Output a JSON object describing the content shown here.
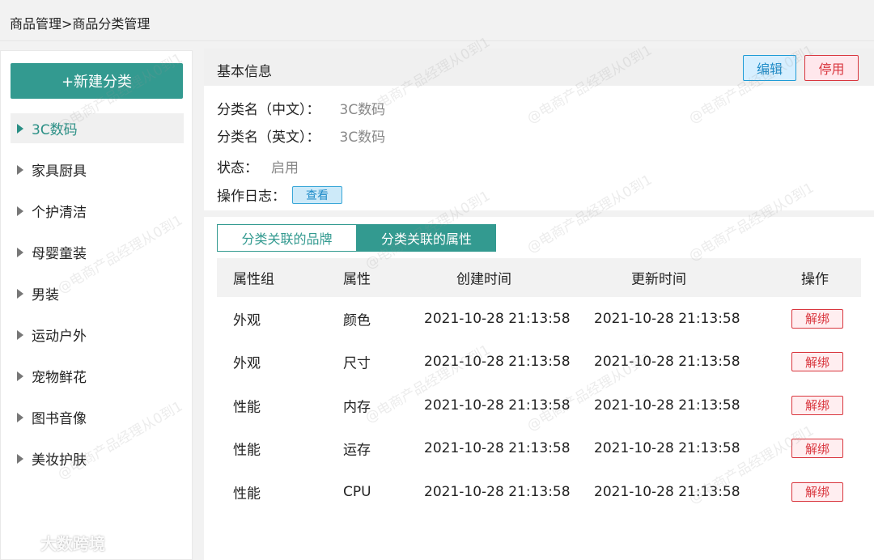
{
  "breadcrumb": "商品管理>商品分类管理",
  "sidebar": {
    "new_button": "+新建分类",
    "categories": [
      {
        "label": "3C数码",
        "active": true
      },
      {
        "label": "家具厨具"
      },
      {
        "label": "个护清洁"
      },
      {
        "label": "母婴童装"
      },
      {
        "label": "男装"
      },
      {
        "label": "运动户外"
      },
      {
        "label": "宠物鲜花"
      },
      {
        "label": "图书音像"
      },
      {
        "label": "美妆护肤"
      }
    ]
  },
  "info": {
    "title": "基本信息",
    "edit_label": "编辑",
    "disable_label": "停用",
    "name_cn_label": "分类名（中文）：",
    "name_cn_value": "3C数码",
    "name_en_label": "分类名（英文）：",
    "name_en_value": "3C数码",
    "status_label": "状态：",
    "status_value": "启用",
    "log_label": "操作日志：",
    "log_view_label": "查看"
  },
  "tabs": {
    "brand": "分类关联的品牌",
    "attribute": "分类关联的属性",
    "active": "attribute"
  },
  "table": {
    "headers": [
      "属性组",
      "属性",
      "创建时间",
      "更新时间",
      "操作"
    ],
    "rows": [
      {
        "group": "外观",
        "attr": "颜色",
        "created": "2021-10-28 21:13:58",
        "updated": "2021-10-28 21:13:58",
        "action": "解绑"
      },
      {
        "group": "外观",
        "attr": "尺寸",
        "created": "2021-10-28 21:13:58",
        "updated": "2021-10-28 21:13:58",
        "action": "解绑"
      },
      {
        "group": "性能",
        "attr": "内存",
        "created": "2021-10-28 21:13:58",
        "updated": "2021-10-28 21:13:58",
        "action": "解绑"
      },
      {
        "group": "性能",
        "attr": "运存",
        "created": "2021-10-28 21:13:58",
        "updated": "2021-10-28 21:13:58",
        "action": "解绑"
      },
      {
        "group": "性能",
        "attr": "CPU",
        "created": "2021-10-28 21:13:58",
        "updated": "2021-10-28 21:13:58",
        "action": "解绑"
      }
    ]
  },
  "watermark_text": "@电商产品经理从0到1",
  "brand_logo_text": "大数跨境",
  "colors": {
    "accent": "#339a90",
    "edit": "#1e8bc8",
    "danger": "#d9363e"
  }
}
